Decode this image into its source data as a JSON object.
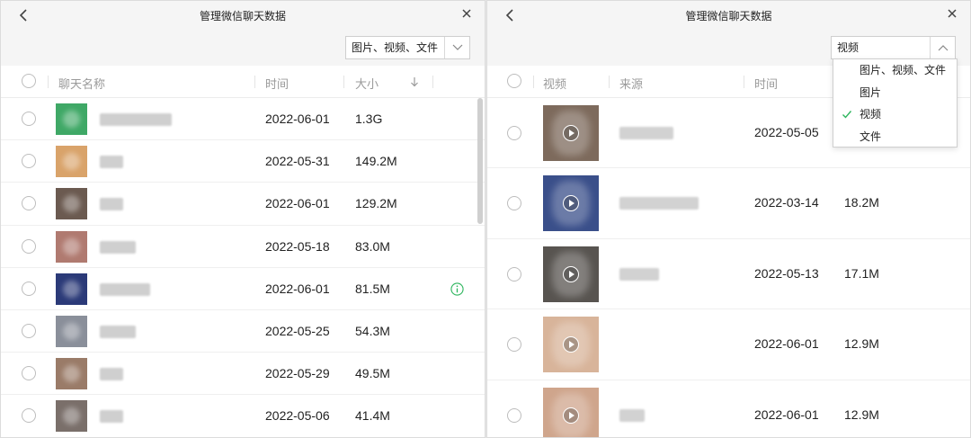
{
  "left_window": {
    "title": "管理微信聊天数据",
    "filter_value": "图片、视频、文件",
    "columns": {
      "name": "聊天名称",
      "time": "时间",
      "size": "大小"
    },
    "rows": [
      {
        "date": "2022-06-01",
        "size": "1.3G",
        "thumb_color": "#3fa866",
        "info_icon": false
      },
      {
        "date": "2022-05-31",
        "size": "149.2M",
        "thumb_color": "#d9a36a",
        "info_icon": false
      },
      {
        "date": "2022-06-01",
        "size": "129.2M",
        "thumb_color": "#6b5a50",
        "info_icon": false
      },
      {
        "date": "2022-05-18",
        "size": "83.0M",
        "thumb_color": "#b07a70",
        "info_icon": false
      },
      {
        "date": "2022-06-01",
        "size": "81.5M",
        "thumb_color": "#2b3a78",
        "info_icon": true
      },
      {
        "date": "2022-05-25",
        "size": "54.3M",
        "thumb_color": "#8a8f9a",
        "info_icon": false
      },
      {
        "date": "2022-05-29",
        "size": "49.5M",
        "thumb_color": "#9a7b68",
        "info_icon": false
      },
      {
        "date": "2022-05-06",
        "size": "41.4M",
        "thumb_color": "#7a6f6a",
        "info_icon": false
      }
    ]
  },
  "right_window": {
    "title": "管理微信聊天数据",
    "filter_value": "视频",
    "columns": {
      "video": "视频",
      "source": "来源",
      "time": "时间"
    },
    "dropdown_options": [
      {
        "label": "图片、视频、文件",
        "checked": false
      },
      {
        "label": "图片",
        "checked": false
      },
      {
        "label": "视频",
        "checked": true
      },
      {
        "label": "文件",
        "checked": false
      }
    ],
    "rows": [
      {
        "date": "2022-05-05",
        "size": "",
        "thumb_color": "#7d6a5c",
        "has_source": true
      },
      {
        "date": "2022-03-14",
        "size": "18.2M",
        "thumb_color": "#3a4f8a",
        "has_source": true
      },
      {
        "date": "2022-05-13",
        "size": "17.1M",
        "thumb_color": "#585450",
        "has_source": true
      },
      {
        "date": "2022-06-01",
        "size": "12.9M",
        "thumb_color": "#d8b49a",
        "has_source": false
      },
      {
        "date": "2022-06-01",
        "size": "12.9M",
        "thumb_color": "#cfa58c",
        "has_source": true
      }
    ]
  },
  "colors": {
    "accent_green": "#2db55d",
    "header_text": "#9a9a9a"
  },
  "icons": {
    "back": "chevron-left-icon",
    "close": "close-icon",
    "info": "info-circle-icon",
    "sort": "arrow-down-icon",
    "play": "play-icon",
    "check": "check-icon"
  }
}
